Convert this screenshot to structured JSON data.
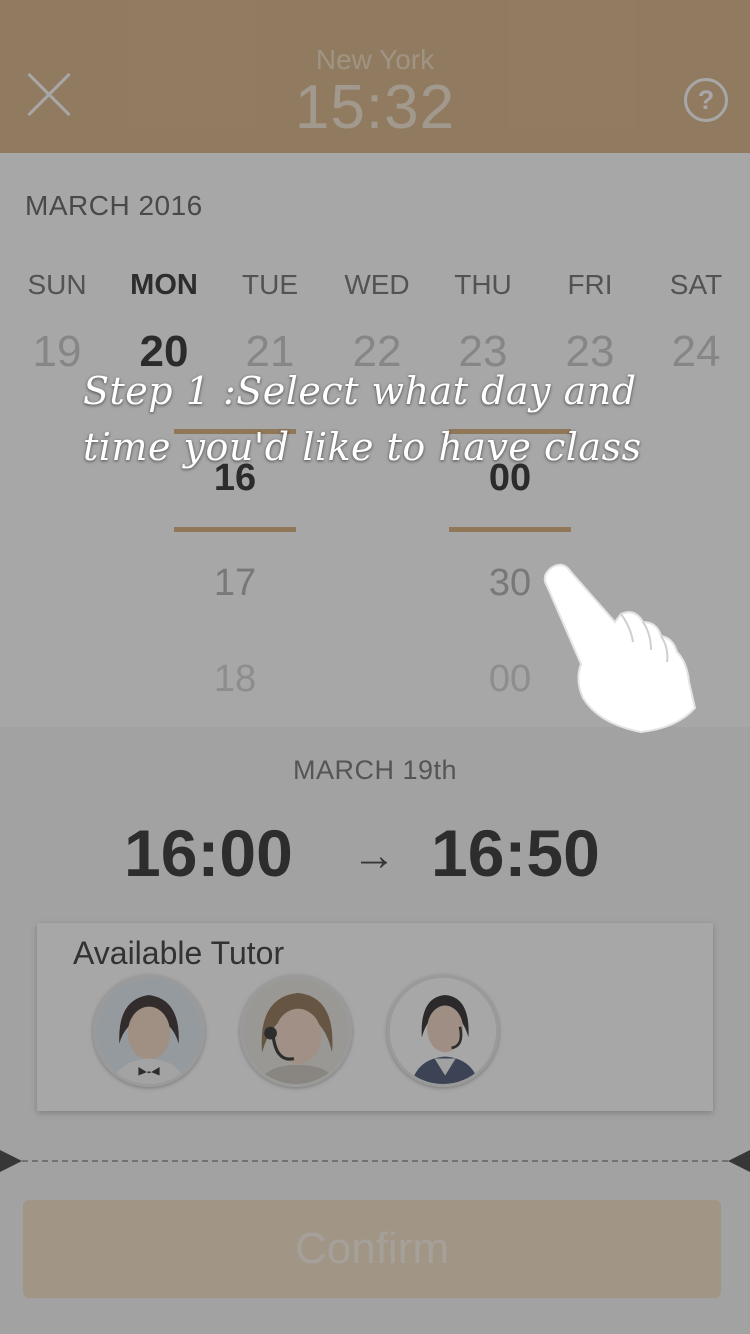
{
  "header": {
    "city": "New York",
    "time": "15:32",
    "help_label": "?"
  },
  "calendar": {
    "month": "MARCH 2016",
    "weekdays": [
      "SUN",
      "MON",
      "TUE",
      "WED",
      "THU",
      "FRI",
      "SAT"
    ],
    "days": [
      "19",
      "20",
      "21",
      "22",
      "23",
      "23",
      "24"
    ],
    "selected_index": 1
  },
  "picker": {
    "hours": [
      "16",
      "17",
      "18"
    ],
    "minutes": [
      "00",
      "30",
      "00"
    ]
  },
  "summary": {
    "date": "MARCH 19th",
    "start": "16:00",
    "arrow": "→",
    "end": "16:50"
  },
  "tutors": {
    "title": "Available Tutor",
    "avatars": [
      "tutor-avatar-1",
      "tutor-avatar-2",
      "tutor-avatar-3"
    ]
  },
  "confirm_label": "Confirm",
  "overlay": {
    "line1": "Step 1 :Select what day and",
    "line2": "time you'd like to have class"
  },
  "colors": {
    "accent": "#d8b07f",
    "selection_line": "#d4a86f",
    "confirm_bg": "#f5dfc2"
  }
}
